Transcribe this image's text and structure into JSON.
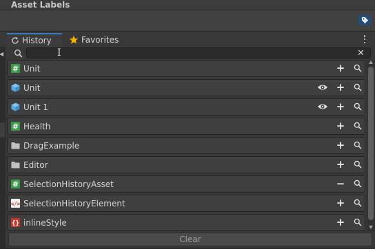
{
  "asset_labels": {
    "title": "Asset Labels"
  },
  "tabs": [
    {
      "label": "History",
      "icon": "history-icon",
      "active": true
    },
    {
      "label": "Favorites",
      "icon": "star-icon",
      "active": false
    }
  ],
  "search": {
    "value": "",
    "placeholder": ""
  },
  "items": [
    {
      "name": "Unit",
      "icon": "script-icon",
      "eye": false,
      "action": "+"
    },
    {
      "name": "Unit",
      "icon": "prefab-icon",
      "eye": true,
      "action": "+"
    },
    {
      "name": "Unit 1",
      "icon": "prefab-icon",
      "eye": true,
      "action": "+"
    },
    {
      "name": "Health",
      "icon": "script-icon",
      "eye": false,
      "action": "+"
    },
    {
      "name": "DragExample",
      "icon": "folder-icon",
      "eye": false,
      "action": "+"
    },
    {
      "name": "Editor",
      "icon": "folder-icon",
      "eye": false,
      "action": "+"
    },
    {
      "name": "SelectionHistoryAsset",
      "icon": "script-icon",
      "eye": false,
      "action": "−"
    },
    {
      "name": "SelectionHistoryElement",
      "icon": "uxml-icon",
      "eye": false,
      "action": "+"
    },
    {
      "name": "inlineStyle",
      "icon": "uss-icon",
      "eye": false,
      "action": "+"
    }
  ],
  "clear_label": "Clear",
  "colors": {
    "accent": "#3a79bb",
    "star": "#f4b400",
    "script": "#3a9b4b",
    "prefab": "#4aa0d8"
  }
}
